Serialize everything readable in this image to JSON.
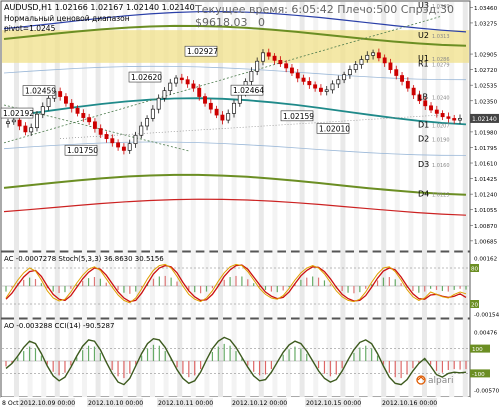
{
  "header": {
    "symbol_line": "AUDUSD,H1  1.02166 1.02167 1.02140 1.02140",
    "indicator_name": "Нормальный ценовой диапазон",
    "pivot_label": "pivot=1.0245",
    "time_label": "Текущее время: 6:05:42 Плечо:500 Спрэд:30",
    "balance_label": "$9618.03",
    "zero_label": "0"
  },
  "main_axis": {
    "ticks": [
      "1.03460",
      "1.03275",
      "1.02905",
      "1.02720",
      "1.02535",
      "1.02350",
      "1.02140",
      "1.01980",
      "1.01795",
      "1.01610",
      "1.01425",
      "1.01240",
      "1.01055",
      "1.00870",
      "1.00685"
    ],
    "current_price": "1.02140"
  },
  "levels": [
    {
      "name": "U3",
      "value": "1.0349"
    },
    {
      "name": "U2",
      "value": "1.0313"
    },
    {
      "name": "U1",
      "value": "1.0286"
    },
    {
      "name": "R1",
      "value": "1.0279"
    },
    {
      "name": "LB",
      "value": "1.0240"
    },
    {
      "name": "D1",
      "value": "1.0207"
    },
    {
      "name": "D2",
      "value": "1.0190"
    },
    {
      "name": "D3",
      "value": "1.0160"
    },
    {
      "name": "D4",
      "value": "1.0125"
    }
  ],
  "callouts": [
    "1.02192",
    "1.02459",
    "1.01750",
    "1.02620",
    "1.02927",
    "1.02464",
    "1.02159",
    "1.02010"
  ],
  "ac_panel": {
    "label": "AC -0.0007278  Stoch(5,3,3) 36.8630 30.5156",
    "ticks": [
      "0.00162",
      "80",
      "20",
      "-0.00154"
    ]
  },
  "ao_panel": {
    "label": "AO -0.003288  CCI(14) -90.5287",
    "ticks": [
      "0.00476",
      "100",
      "-100",
      "-0.00570"
    ]
  },
  "time_axis": [
    "8 Oct 2012",
    "2012.10.09 00:00",
    "2012.10.10 00:00",
    "2012.10.11 00:00",
    "2012.10.12 00:00",
    "2012.10.15 00:00",
    "2012.10.16 00:00"
  ],
  "brand": "alpari",
  "colors": {
    "candle_up": "#1a1a1a",
    "candle_down": "#cc0000",
    "level_band": "#f0e08a",
    "teal_ma": "#1f8a8a",
    "green_band": "#6b8e23",
    "blue_band": "#2a3fa8",
    "red_band": "#cc2222"
  },
  "chart_data": [
    {
      "type": "candlestick",
      "title": "AUDUSD,H1",
      "ylim": [
        1.006,
        1.035
      ],
      "y_ticks": [
        1.0346,
        1.03275,
        1.02905,
        1.0272,
        1.02535,
        1.0235,
        1.0214,
        1.0198,
        1.01795,
        1.0161,
        1.01425,
        1.0124,
        1.01055,
        1.0087,
        1.00685
      ],
      "close_series": [
        1.021,
        1.0212,
        1.0205,
        1.0198,
        1.0203,
        1.0219,
        1.0228,
        1.0238,
        1.0246,
        1.024,
        1.0232,
        1.0226,
        1.022,
        1.0215,
        1.021,
        1.0202,
        1.0195,
        1.019,
        1.0185,
        1.018,
        1.0176,
        1.0184,
        1.0194,
        1.0205,
        1.0214,
        1.0225,
        1.0238,
        1.0247,
        1.0256,
        1.0262,
        1.026,
        1.0255,
        1.025,
        1.024,
        1.0232,
        1.0225,
        1.0218,
        1.0212,
        1.022,
        1.0232,
        1.0245,
        1.0258,
        1.027,
        1.0282,
        1.0292,
        1.0288,
        1.0283,
        1.0279,
        1.0274,
        1.0268,
        1.0262,
        1.0258,
        1.0254,
        1.025,
        1.0246,
        1.0248,
        1.0255,
        1.026,
        1.0266,
        1.0272,
        1.0278,
        1.0284,
        1.0289,
        1.0292,
        1.0286,
        1.028,
        1.0272,
        1.0265,
        1.0258,
        1.025,
        1.0242,
        1.0235,
        1.0229,
        1.0224,
        1.022,
        1.0216,
        1.0214,
        1.0212,
        1.0214
      ],
      "price_labels": [
        {
          "label": "1.02192",
          "value": 1.02192
        },
        {
          "label": "1.02459",
          "value": 1.02459
        },
        {
          "label": "1.01750",
          "value": 1.0175
        },
        {
          "label": "1.02620",
          "value": 1.0262
        },
        {
          "label": "1.02927",
          "value": 1.02927
        },
        {
          "label": "1.02464",
          "value": 1.02464
        },
        {
          "label": "1.02159",
          "value": 1.02159
        },
        {
          "label": "1.02010",
          "value": 1.0201
        }
      ],
      "levels": {
        "U3": 1.0349,
        "U2": 1.0313,
        "U1": 1.0286,
        "R1": 1.0279,
        "LB": 1.024,
        "D1": 1.0207,
        "D2": 1.019,
        "D3": 1.016,
        "D4": 1.0125
      }
    },
    {
      "type": "histogram+line",
      "title": "AC -0.0007278 Stoch(5,3,3) 36.8630 30.5156",
      "ylim": [
        -0.00154,
        0.00162
      ],
      "stoch_levels": [
        80,
        20
      ],
      "stoch_k": [
        30,
        45,
        60,
        72,
        80,
        75,
        60,
        42,
        30,
        25,
        28,
        40,
        55,
        68,
        78,
        82,
        76,
        62,
        48,
        35,
        26,
        22,
        30,
        45,
        62,
        76,
        84,
        86,
        80,
        66,
        50,
        36,
        28,
        24,
        30,
        42,
        58,
        72,
        82,
        86,
        84,
        74,
        60,
        46,
        36,
        30,
        28,
        34,
        46,
        60,
        72,
        80,
        84,
        80,
        70,
        56,
        42,
        32,
        26,
        24,
        28,
        40,
        56,
        70,
        80,
        82,
        74,
        60,
        44,
        32,
        26,
        30,
        40,
        36,
        32,
        30,
        36,
        40,
        37
      ],
      "stoch_d": [
        28,
        38,
        52,
        65,
        74,
        76,
        66,
        50,
        36,
        28,
        26,
        34,
        48,
        62,
        73,
        80,
        78,
        68,
        54,
        40,
        30,
        24,
        26,
        38,
        54,
        70,
        80,
        84,
        82,
        72,
        56,
        42,
        32,
        26,
        27,
        36,
        50,
        66,
        77,
        84,
        85,
        78,
        65,
        52,
        40,
        33,
        29,
        31,
        40,
        54,
        67,
        76,
        82,
        81,
        74,
        62,
        48,
        36,
        29,
        25,
        26,
        34,
        48,
        63,
        75,
        80,
        77,
        65,
        50,
        37,
        29,
        28,
        35,
        36,
        33,
        31,
        33,
        37,
        31
      ]
    },
    {
      "type": "histogram+line",
      "title": "AO -0.003288 CCI(14) -90.5287",
      "ylim": [
        -0.0057,
        0.00476
      ],
      "cci_levels": [
        100,
        -100
      ],
      "cci": [
        -60,
        -20,
        40,
        110,
        160,
        140,
        60,
        -40,
        -120,
        -160,
        -130,
        -50,
        40,
        120,
        170,
        160,
        90,
        -10,
        -100,
        -170,
        -190,
        -140,
        -40,
        60,
        140,
        180,
        170,
        110,
        20,
        -70,
        -140,
        -180,
        -160,
        -90,
        10,
        100,
        160,
        190,
        170,
        110,
        30,
        -50,
        -120,
        -160,
        -150,
        -90,
        -10,
        70,
        130,
        160,
        140,
        80,
        0,
        -80,
        -140,
        -170,
        -150,
        -80,
        10,
        90,
        150,
        170,
        140,
        60,
        -40,
        -130,
        -180,
        -190,
        -150,
        -80,
        -20,
        20,
        -40,
        -110,
        -130,
        -100,
        -90,
        -95,
        -90
      ]
    }
  ]
}
